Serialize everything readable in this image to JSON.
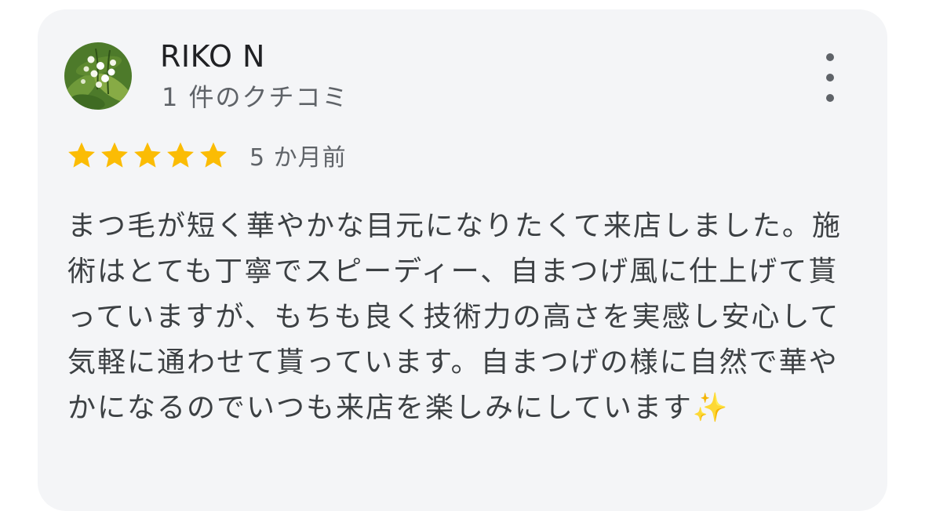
{
  "review": {
    "user_name": "RIKO N",
    "review_count": "1 件のクチコミ",
    "rating": 5,
    "rating_max": 5,
    "star_color": "#fbbc04",
    "time_ago": "5 か月前",
    "text": "まつ毛が短く華やかな目元になりたくて来店しました。施術はとても丁寧でスピーディー、自まつげ風に仕上げて貰っていますが、もちも良く技術力の高さを実感し安心して気軽に通わせて貰っています。自まつげの様に自然で華やかになるのでいつも来店を楽しみにしています✨"
  },
  "icons": {
    "more": "more-vert-icon",
    "star": "star-icon",
    "avatar": "flower-photo"
  }
}
